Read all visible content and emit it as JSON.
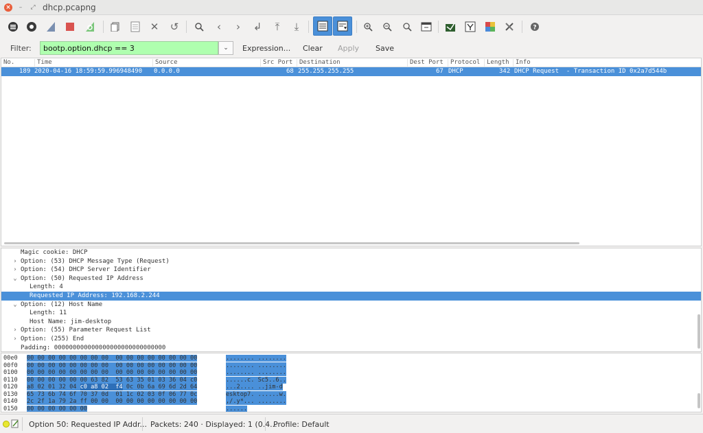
{
  "window": {
    "title": "dhcp.pcapng"
  },
  "filter": {
    "label": "Filter:",
    "value": "bootp.option.dhcp == 3",
    "buttons": {
      "expression": "Expression...",
      "clear": "Clear",
      "apply": "Apply",
      "save": "Save"
    }
  },
  "packet_list": {
    "columns": [
      "No.",
      "Time",
      "Source",
      "Src Port",
      "Destination",
      "Dest Port",
      "Protocol",
      "Length",
      "Info"
    ],
    "rows": [
      {
        "no": "189",
        "time": "2020-04-16 18:59:59.996948490",
        "source": "0.0.0.0",
        "src_port": "68",
        "destination": "255.255.255.255",
        "dest_port": "67",
        "protocol": "DHCP",
        "length": "342",
        "info": "DHCP Request  - Transaction ID 0x2a7d544b"
      }
    ]
  },
  "detail_tree": [
    {
      "text": "Magic cookie: DHCP",
      "arrow": "",
      "indent": 0,
      "selected": false
    },
    {
      "text": "Option: (53) DHCP Message Type (Request)",
      "arrow": ">",
      "indent": 0,
      "selected": false
    },
    {
      "text": "Option: (54) DHCP Server Identifier",
      "arrow": ">",
      "indent": 0,
      "selected": false
    },
    {
      "text": "Option: (50) Requested IP Address",
      "arrow": "v",
      "indent": 0,
      "selected": false
    },
    {
      "text": "Length: 4",
      "arrow": "",
      "indent": 1,
      "selected": false
    },
    {
      "text": "Requested IP Address: 192.168.2.244",
      "arrow": "",
      "indent": 1,
      "selected": true
    },
    {
      "text": "Option: (12) Host Name",
      "arrow": "v",
      "indent": 0,
      "selected": false
    },
    {
      "text": "Length: 11",
      "arrow": "",
      "indent": 1,
      "selected": false
    },
    {
      "text": "Host Name: jim-desktop",
      "arrow": "",
      "indent": 1,
      "selected": false
    },
    {
      "text": "Option: (55) Parameter Request List",
      "arrow": ">",
      "indent": 0,
      "selected": false
    },
    {
      "text": "Option: (255) End",
      "arrow": ">",
      "indent": 0,
      "selected": false
    },
    {
      "text": "Padding: 000000000000000000000000000000",
      "arrow": "",
      "indent": 0,
      "selected": false
    }
  ],
  "hex_dump": [
    {
      "offset": "00e0",
      "bytes": "00 00 00 00 00 00 00 00  00 00 00 00 00 00 00 00",
      "ascii": "........ ........"
    },
    {
      "offset": "00f0",
      "bytes": "00 00 00 00 00 00 00 00  00 00 00 00 00 00 00 00",
      "ascii": "........ ........"
    },
    {
      "offset": "0100",
      "bytes": "00 00 00 00 00 00 00 00  00 00 00 00 00 00 00 00",
      "ascii": "........ ........"
    },
    {
      "offset": "0110",
      "bytes": "00 00 00 00 00 00 63 82  53 63 35 01 03 36 04 c0",
      "ascii": "......c. Sc5..6.."
    },
    {
      "offset": "0120",
      "bytes_a": "a8 02 01 32 04 ",
      "bytes_sel": "c0 a8 02  f4",
      "bytes_b": " 0c 0b 6a 69 6d 2d 64",
      "ascii": "...2.... ..jim-d"
    },
    {
      "offset": "0130",
      "bytes": "65 73 6b 74 6f 70 37 0d  01 1c 02 03 0f 06 77 0c",
      "ascii": "esktop7. ......w."
    },
    {
      "offset": "0140",
      "bytes": "2c 2f 1a 79 2a ff 00 00  00 00 00 00 00 00 00 00",
      "ascii": ",/.y*... ........"
    },
    {
      "offset": "0150",
      "bytes": "00 00 00 00 00 00",
      "ascii": "......"
    }
  ],
  "status_bar": {
    "field": "Option 50: Requested IP Addr...",
    "packets": "Packets: 240 · Displayed: 1 (0.4...",
    "profile": "Profile: Default"
  },
  "colors": {
    "selection": "#4a90d9",
    "filter_valid": "#afffaf"
  }
}
